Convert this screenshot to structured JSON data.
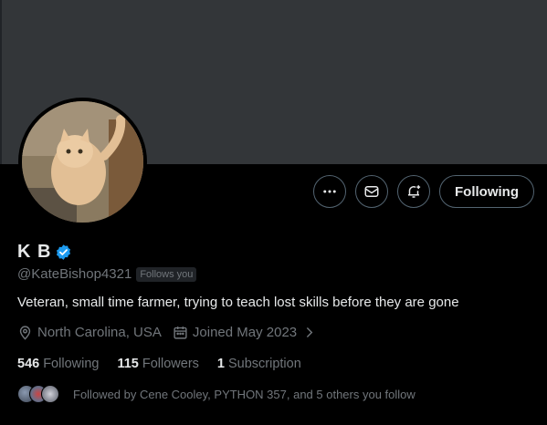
{
  "profile": {
    "display_name": "K B",
    "handle": "@KateBishop4321",
    "follows_you_badge": "Follows you",
    "bio": "Veteran, small time farmer, trying to teach lost skills before they are gone",
    "location": "North Carolina, USA",
    "joined": "Joined May 2023"
  },
  "actions": {
    "more_icon": "more-icon",
    "message_icon": "mail-icon",
    "notify_icon": "bell-plus-icon",
    "follow_label": "Following"
  },
  "stats": {
    "following_count": "546",
    "following_label": "Following",
    "followers_count": "115",
    "followers_label": "Followers",
    "subscription_count": "1",
    "subscription_label": "Subscription"
  },
  "followed_by": {
    "text": "Followed by Cene Cooley, PYTHON 357, and 5 others you follow"
  },
  "colors": {
    "background": "#000000",
    "banner": "#333639",
    "muted_text": "#71767b",
    "primary_text": "#e7e9ea",
    "verified_blue": "#1d9bf0",
    "button_border": "#536471"
  }
}
